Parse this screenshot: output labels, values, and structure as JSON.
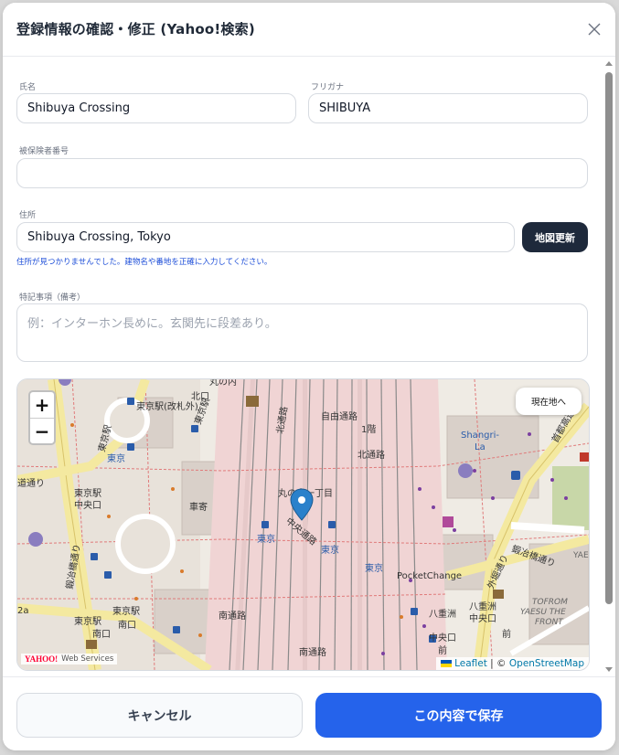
{
  "dialog": {
    "title": "登録情報の確認・修正 (Yahoo!検索)"
  },
  "form": {
    "name": {
      "label": "氏名",
      "value": "Shibuya Crossing"
    },
    "kana": {
      "label": "フリガナ",
      "value": "SHIBUYA"
    },
    "insurance": {
      "label": "被保険者番号",
      "value": ""
    },
    "address": {
      "label": "住所",
      "value": "Shibuya Crossing, Tokyo",
      "update_button": "地図更新",
      "hint": "住所が見つかりませんでした。建物名や番地を正確に入力してください。"
    },
    "notes": {
      "label": "特記事項（備考）",
      "placeholder": "例：インターホン長めに。玄関先に段差あり。"
    }
  },
  "map": {
    "zoom_in": "+",
    "zoom_out": "−",
    "locate_button": "現在地へ",
    "provider_logo": "YAHOO!",
    "provider_text": "Web Services",
    "attribution_leaflet": "Leaflet",
    "attribution_sep": " | © ",
    "attribution_osm": "OpenStreetMap",
    "labels": {
      "l1": "丸の内",
      "l2": "北口",
      "l3": "東京駅(改札外)",
      "l4": "東京駅",
      "l5": "北通路",
      "l6": "自由通路",
      "l7": "1階",
      "l8": "北通路",
      "l9": "東京",
      "l10": "東京",
      "l11": "東京",
      "l12": "東京駅",
      "l13": "中央口",
      "l14": "丸の内一丁目",
      "l15": "中央通路",
      "l16": "東京",
      "l17": "東京駅",
      "l18": "南口",
      "l19": "南通路",
      "l20": "南通路",
      "l21": "PocketChange",
      "l22": "八重洲",
      "l23": "中央口",
      "l24": "八重洲",
      "l25": "中央口",
      "l26": "前",
      "l27": "前",
      "l28": "外堀通り",
      "l29": "鍛冶橋通り",
      "l30": "TOFROM",
      "l31": "YAESU THE",
      "l32": "FRONT",
      "l33": "Shangri-",
      "l34": "La",
      "l35": "首都高速",
      "l36": "鍛冶橋通り",
      "l37": "東京駅",
      "l38": "道通り",
      "l39": "車寄",
      "l40": "YAE",
      "l41": "東京駅",
      "l42": "南口",
      "l43": "2a"
    }
  },
  "footer": {
    "cancel": "キャンセル",
    "save": "この内容で保存"
  },
  "colors": {
    "primary": "#2563eb",
    "dark_button": "#1e293b",
    "hint": "#1d4ed8",
    "marker": "#2a81cb"
  }
}
